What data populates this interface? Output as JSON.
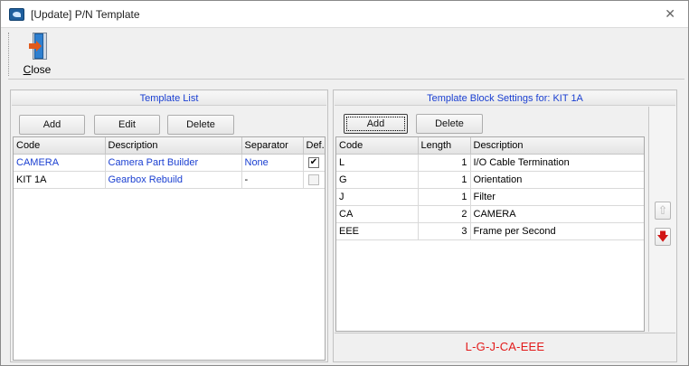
{
  "window": {
    "title": "[Update] P/N Template",
    "close_glyph": "✕"
  },
  "toolbar": {
    "close_label_first": "C",
    "close_label_rest": "lose"
  },
  "template_list": {
    "header": "Template List",
    "buttons": {
      "add": "Add",
      "edit": "Edit",
      "delete": "Delete"
    },
    "columns": [
      "Code",
      "Description",
      "Separator",
      "Def."
    ],
    "rows": [
      {
        "code": "CAMERA",
        "description": "Camera Part Builder",
        "separator": "None",
        "default": true,
        "checkmark": "✔"
      },
      {
        "code": "KIT 1A",
        "description": "Gearbox Rebuild",
        "separator": "-",
        "default": false,
        "checkmark": ""
      }
    ]
  },
  "block_settings": {
    "header": "Template Block Settings for: KIT 1A",
    "buttons": {
      "add": "Add",
      "delete": "Delete"
    },
    "columns": [
      "Code",
      "Length",
      "Description"
    ],
    "rows": [
      {
        "code": "L",
        "length": "1",
        "description": "I/O Cable Termination"
      },
      {
        "code": "G",
        "length": "1",
        "description": "Orientation"
      },
      {
        "code": "J",
        "length": "1",
        "description": "Filter"
      },
      {
        "code": "CA",
        "length": "2",
        "description": "CAMERA"
      },
      {
        "code": "EEE",
        "length": "3",
        "description": "Frame per Second"
      }
    ],
    "move_up_glyph": "⇧",
    "move_down_glyph": "🡇",
    "result": "L-G-J-CA-EEE"
  },
  "icons": {
    "app": "app-logo-icon",
    "close_door": "exit-door-icon",
    "move_up": "arrow-up-icon",
    "move_down": "arrow-down-icon"
  },
  "colors": {
    "link_blue": "#1a3fd1",
    "result_red": "#e21a1a",
    "down_arrow_red": "#d11515"
  }
}
